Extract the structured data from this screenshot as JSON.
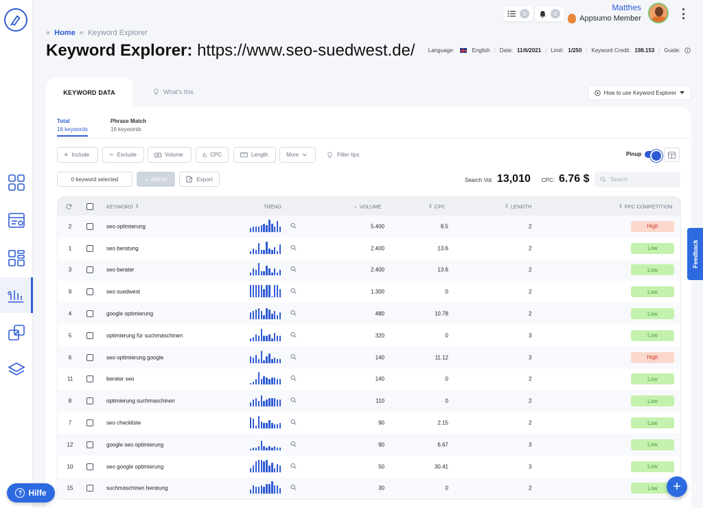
{
  "header": {
    "user_name": "Matthes",
    "user_role": "Appsumo Member",
    "tasks_count": "0",
    "notifications_count": "0"
  },
  "breadcrumb": {
    "sep1": "«",
    "home": "Home",
    "sep2": "«",
    "current": "Keyword Explorer"
  },
  "page": {
    "title_bold": "Keyword Explorer:",
    "title_url": "https://www.seo-suedwest.de/"
  },
  "meta": {
    "language_label": "Language:",
    "language_value": "English",
    "date_label": "Date:",
    "date_value": "11/6/2021",
    "limit_label": "Limit:",
    "limit_value": "1/250",
    "credit_label": "Keyword Credit:",
    "credit_value": "198.153",
    "guide_label": "Guide:"
  },
  "tabs": {
    "keyword_data": "KEYWORD DATA",
    "whats_this": "What's this",
    "how_to": "How to use Keyword Explorer"
  },
  "subtabs": [
    {
      "title": "Total",
      "sub": "16 keywords"
    },
    {
      "title": "Phrase Match",
      "sub": "16 keywords"
    }
  ],
  "filters": {
    "include": "Include",
    "exclude": "Exclude",
    "volume": "Volume",
    "cpc": "CPC",
    "length": "Length",
    "more": "More",
    "filter_tips": "Filter tips",
    "pinup": "Pinup"
  },
  "actions": {
    "selected": "0 keyword selected",
    "add_to": "Add to",
    "export": "Export",
    "search_placeholder": "Search"
  },
  "stats": {
    "search_vol_label": "Search Vol:",
    "search_vol_value": "13,010",
    "cpc_label": "CPC:",
    "cpc_value": "6.76 $"
  },
  "table": {
    "headers": {
      "keyword": "KEYWORD",
      "trend": "TREND",
      "volume": "VOLUME",
      "cpc": "CPC",
      "length": "LENGTH",
      "ppc": "PPC COMPETITION"
    },
    "rows": [
      {
        "num": "2",
        "keyword": "seo optimierung",
        "volume": "5.400",
        "cpc": "8.5",
        "length": "2",
        "ppc": "High",
        "trend": [
          3,
          4,
          4,
          4,
          5,
          6,
          5,
          9,
          6,
          4,
          8,
          4
        ]
      },
      {
        "num": "1",
        "keyword": "seo beratung",
        "volume": "2.400",
        "cpc": "13.6",
        "length": "2",
        "ppc": "Low",
        "trend": [
          2,
          4,
          3,
          8,
          3,
          3,
          9,
          4,
          3,
          5,
          2,
          7
        ]
      },
      {
        "num": "3",
        "keyword": "seo berater",
        "volume": "2.400",
        "cpc": "13.6",
        "length": "2",
        "ppc": "Low",
        "trend": [
          2,
          5,
          4,
          9,
          3,
          3,
          7,
          5,
          2,
          5,
          2,
          4
        ]
      },
      {
        "num": "9",
        "keyword": "seo suedwest",
        "volume": "1.300",
        "cpc": "0",
        "length": "2",
        "ppc": "Low",
        "trend": [
          9,
          9,
          9,
          9,
          9,
          6,
          9,
          9,
          0,
          9,
          9,
          6
        ]
      },
      {
        "num": "4",
        "keyword": "google optimierung",
        "volume": "480",
        "cpc": "10.78",
        "length": "2",
        "ppc": "Low",
        "trend": [
          5,
          6,
          7,
          8,
          6,
          3,
          8,
          7,
          4,
          6,
          3,
          5
        ]
      },
      {
        "num": "5",
        "keyword": "optimierung für suchmaschinen",
        "volume": "320",
        "cpc": "0",
        "length": "3",
        "ppc": "Low",
        "trend": [
          2,
          3,
          5,
          4,
          9,
          4,
          4,
          5,
          2,
          6,
          4,
          4
        ]
      },
      {
        "num": "6",
        "keyword": "seo optimierung google",
        "volume": "140",
        "cpc": "11.12",
        "length": "3",
        "ppc": "High",
        "trend": [
          5,
          4,
          6,
          3,
          9,
          2,
          5,
          7,
          3,
          4,
          3,
          3
        ]
      },
      {
        "num": "11",
        "keyword": "berater seo",
        "volume": "140",
        "cpc": "0",
        "length": "2",
        "ppc": "Low",
        "trend": [
          1,
          2,
          4,
          9,
          4,
          6,
          5,
          4,
          5,
          5,
          4,
          4
        ]
      },
      {
        "num": "8",
        "keyword": "optimierung suchmaschinen",
        "volume": "110",
        "cpc": "0",
        "length": "2",
        "ppc": "Low",
        "trend": [
          3,
          5,
          6,
          4,
          8,
          4,
          5,
          6,
          6,
          6,
          5,
          5
        ]
      },
      {
        "num": "7",
        "keyword": "seo checkliste",
        "volume": "90",
        "cpc": "2.15",
        "length": "2",
        "ppc": "Low",
        "trend": [
          8,
          7,
          2,
          9,
          5,
          4,
          4,
          6,
          4,
          3,
          3,
          4
        ]
      },
      {
        "num": "12",
        "keyword": "google seo optimierung",
        "volume": "90",
        "cpc": "6.67",
        "length": "3",
        "ppc": "Low",
        "trend": [
          1,
          2,
          2,
          3,
          7,
          3,
          2,
          3,
          2,
          3,
          2,
          2
        ]
      },
      {
        "num": "10",
        "keyword": "seo google optimierung",
        "volume": "50",
        "cpc": "30.41",
        "length": "3",
        "ppc": "Low",
        "trend": [
          3,
          5,
          8,
          9,
          9,
          8,
          9,
          5,
          7,
          3,
          6,
          5
        ]
      },
      {
        "num": "15",
        "keyword": "suchmaschinen beratung",
        "volume": "30",
        "cpc": "0",
        "length": "2",
        "ppc": "Low",
        "trend": [
          3,
          6,
          5,
          5,
          6,
          5,
          7,
          7,
          9,
          6,
          6,
          4
        ]
      }
    ]
  },
  "floating": {
    "feedback": "Feedback",
    "help": "Hilfe",
    "fab": "+"
  },
  "colors": {
    "accent": "#2f5bd3",
    "low_bg": "#c4f2ae",
    "high_bg": "#fbd7cc"
  }
}
